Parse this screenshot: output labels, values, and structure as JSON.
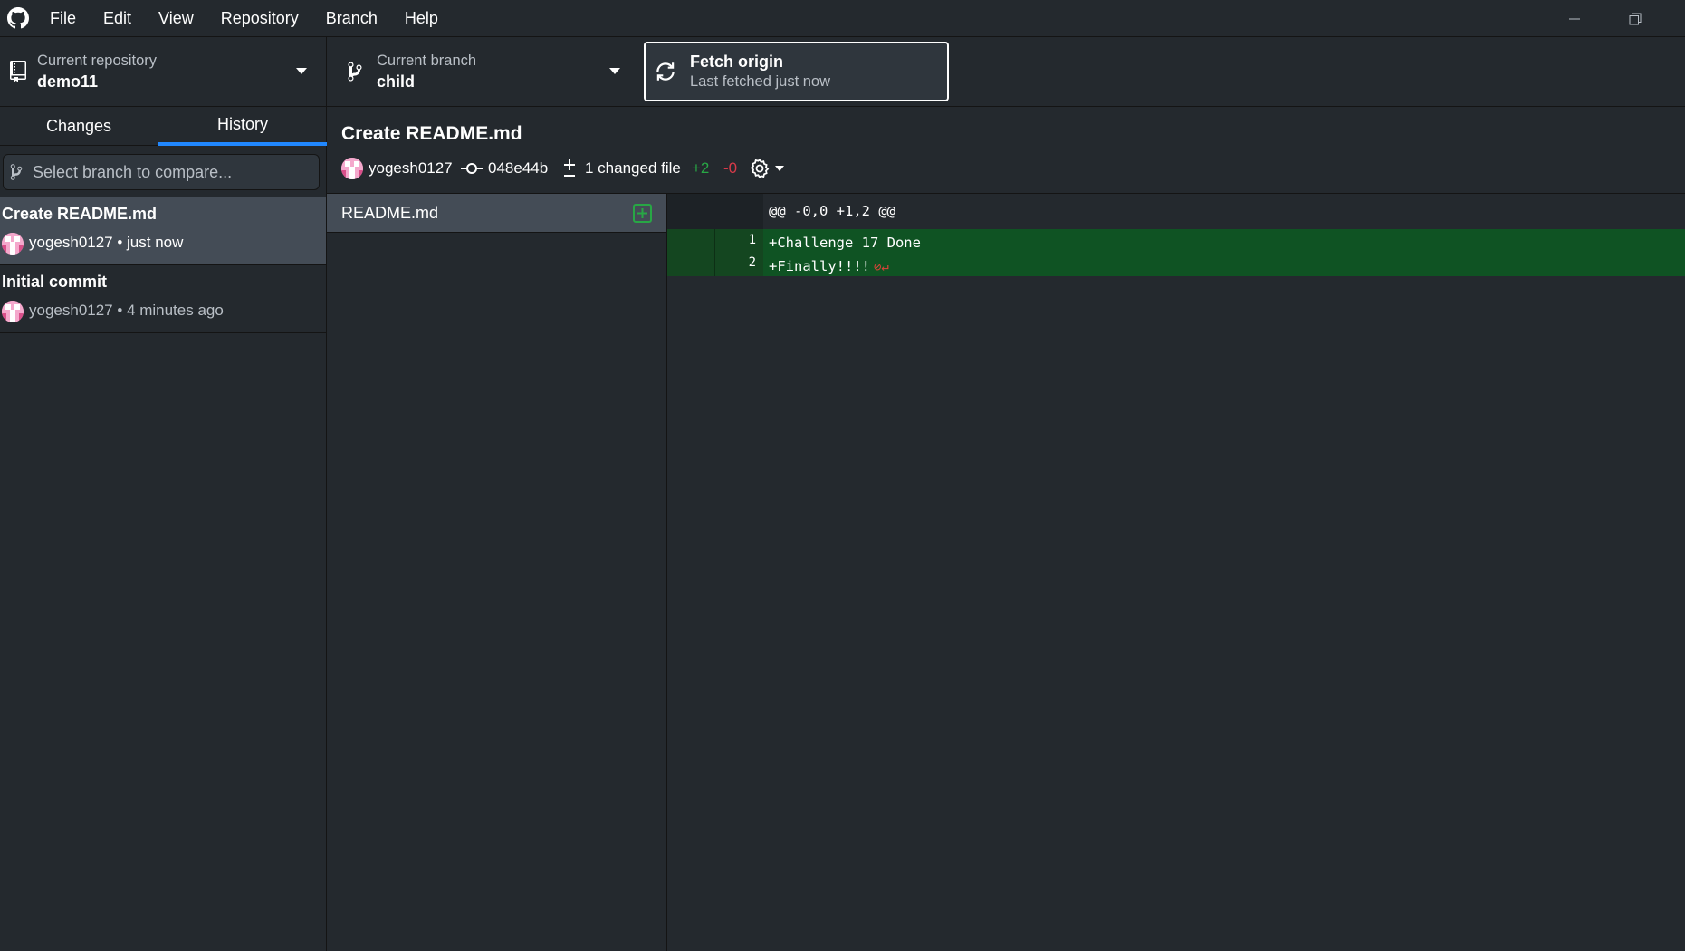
{
  "menubar": {
    "items": [
      "File",
      "Edit",
      "View",
      "Repository",
      "Branch",
      "Help"
    ]
  },
  "toolbar": {
    "repo": {
      "label": "Current repository",
      "value": "demo11"
    },
    "branch": {
      "label": "Current branch",
      "value": "child"
    },
    "fetch": {
      "title": "Fetch origin",
      "subtitle": "Last fetched just now"
    }
  },
  "sidebar": {
    "tabs": [
      {
        "label": "Changes",
        "active": false
      },
      {
        "label": "History",
        "active": true
      }
    ],
    "compare_placeholder": "Select branch to compare...",
    "commits": [
      {
        "title": "Create README.md",
        "meta": "yogesh0127 • just now",
        "selected": true
      },
      {
        "title": "Initial commit",
        "meta": "yogesh0127 • 4 minutes ago",
        "selected": false
      }
    ]
  },
  "commit": {
    "title": "Create README.md",
    "author": "yogesh0127",
    "sha": "048e44b",
    "changed_files": "1 changed file",
    "additions": "+2",
    "deletions": "-0"
  },
  "files": [
    {
      "name": "README.md",
      "status": "added"
    }
  ],
  "diff": {
    "hunk_header": "@@ -0,0 +1,2 @@",
    "lines": [
      {
        "new_no": "1",
        "text": "+Challenge 17 Done"
      },
      {
        "new_no": "2",
        "text": "+Finally!!!!"
      }
    ]
  },
  "colors": {
    "background": "#24292e",
    "accent": "#2188ff",
    "added": "#28a745",
    "removed": "#d73a49",
    "diff_added_bg": "#0f5323"
  }
}
